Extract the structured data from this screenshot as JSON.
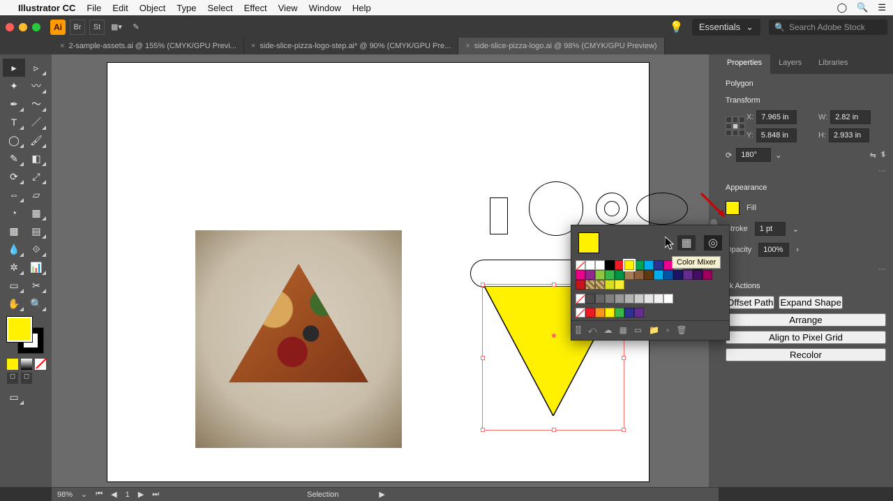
{
  "mac_menu": {
    "app": "Illustrator CC",
    "items": [
      "File",
      "Edit",
      "Object",
      "Type",
      "Select",
      "Effect",
      "View",
      "Window",
      "Help"
    ]
  },
  "workspace": {
    "label": "Essentials"
  },
  "stock_search": {
    "placeholder": "Search Adobe Stock"
  },
  "tabs": [
    {
      "title": "2-sample-assets.ai @ 155% (CMYK/GPU Previ...",
      "active": false
    },
    {
      "title": "side-slice-pizza-logo-step.ai* @ 90% (CMYK/GPU Pre...",
      "active": false
    },
    {
      "title": "side-slice-pizza-logo.ai @ 98% (CMYK/GPU Preview)",
      "active": true
    }
  ],
  "right_panel": {
    "tabs": [
      "Properties",
      "Layers",
      "Libraries"
    ],
    "selection_type": "Polygon",
    "transform_title": "Transform",
    "transform": {
      "x": "7.965 in",
      "y": "5.848 in",
      "w": "2.82 in",
      "h": "2.933 in",
      "angle": "180°"
    },
    "appearance_title": "Appearance",
    "fill_label": "Fill",
    "stroke_label": "Stroke",
    "stroke_val": "1 pt",
    "opacity_label": "Opacity",
    "opacity_val": "100%",
    "quick_title": "ck Actions",
    "buttons": {
      "offset": "Offset Path",
      "expand": "Expand Shape",
      "arrange": "Arrange",
      "align": "Align to Pixel Grid",
      "recolor": "Recolor"
    }
  },
  "swatch_popover": {
    "tooltip": "Color Mixer",
    "current": "#fff100"
  },
  "swatch_rows": [
    [
      "none",
      "reg",
      "#ffffff",
      "#000000",
      "#ed1c24",
      "#fff200",
      "#00a651",
      "#00aeef",
      "#2e3192",
      "#ec008c",
      "#898989",
      "#4d4d4d",
      "#333333"
    ],
    [
      "#ec008c",
      "#92278f",
      "#8dc63f",
      "#39b54a",
      "#009444",
      "#a67c52",
      "#8b5e3c",
      "#603913",
      "#00adee",
      "#0054a6",
      "#1b1464",
      "#662d91",
      "#440e62",
      "#9e005d"
    ],
    [
      "#c4161c",
      "pattern",
      "pattern2",
      "#d7df23",
      "#f9ed32"
    ],
    [
      "none",
      "#4d4d4d",
      "#666",
      "#808080",
      "#999",
      "#b3b3b3",
      "#ccc",
      "#e6e6e6",
      "#f2f2f2",
      "#fff"
    ],
    [
      "none",
      "#ed1c24",
      "#f7941d",
      "#fff200",
      "#39b54a",
      "#2e3192",
      "#662d91"
    ]
  ],
  "status": {
    "zoom": "98%",
    "page": "1",
    "mode": "Selection"
  }
}
